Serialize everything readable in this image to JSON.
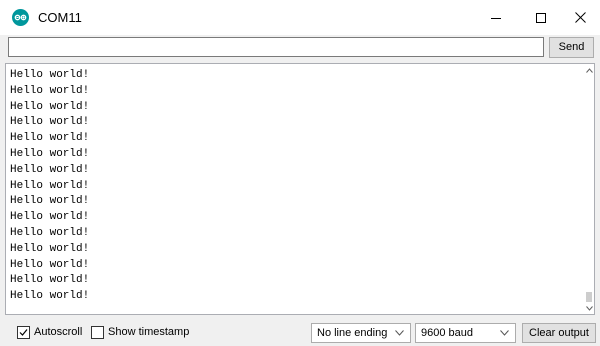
{
  "window": {
    "title": "COM11",
    "app_icon": "arduino-logo-icon",
    "controls": {
      "minimize_icon": "minimize-icon",
      "maximize_icon": "maximize-icon",
      "close_icon": "close-icon"
    }
  },
  "send_bar": {
    "input_value": "",
    "send_label": "Send"
  },
  "output": {
    "lines": [
      "Hello world!",
      "Hello world!",
      "Hello world!",
      "Hello world!",
      "Hello world!",
      "Hello world!",
      "Hello world!",
      "Hello world!",
      "Hello world!",
      "Hello world!",
      "Hello world!",
      "Hello world!",
      "Hello world!",
      "Hello world!",
      "Hello world!"
    ]
  },
  "bottom_bar": {
    "autoscroll": {
      "label": "Autoscroll",
      "checked": true
    },
    "show_timestamp": {
      "label": "Show timestamp",
      "checked": false
    },
    "line_ending": {
      "selected": "No line ending"
    },
    "baud_rate": {
      "selected": "9600 baud"
    },
    "clear_label": "Clear output"
  },
  "colors": {
    "arduino_teal": "#00979c",
    "window_bg": "#f0f0f0",
    "button_bg": "#e1e1e1"
  }
}
